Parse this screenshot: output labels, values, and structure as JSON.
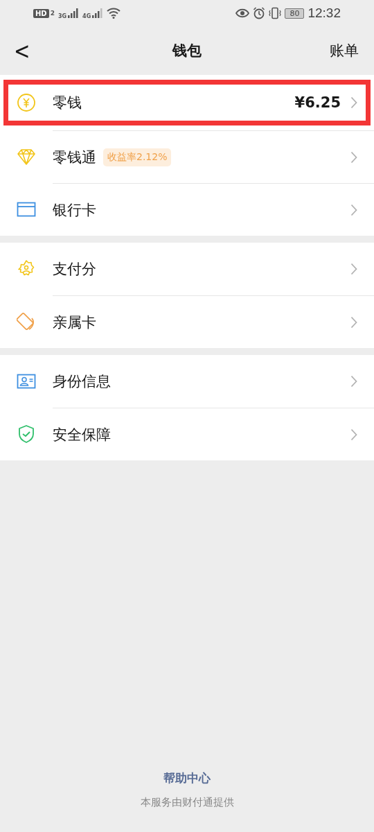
{
  "status_bar": {
    "hd": "HD",
    "sim": "2",
    "network_1": "3G",
    "network_2": "4G",
    "battery": "80",
    "time": "12:32"
  },
  "nav": {
    "back": "<",
    "title": "钱包",
    "action": "账单"
  },
  "groups": [
    {
      "items": [
        {
          "kind": "coin",
          "label": "零钱",
          "value": "¥6.25",
          "highlighted": true
        },
        {
          "kind": "diamond",
          "label": "零钱通",
          "tag": "收益率2.12%",
          "highlighted": false
        },
        {
          "kind": "card",
          "label": "银行卡",
          "highlighted": false
        }
      ]
    },
    {
      "items": [
        {
          "kind": "badge",
          "label": "支付分",
          "highlighted": false
        },
        {
          "kind": "family",
          "label": "亲属卡",
          "highlighted": false
        }
      ]
    },
    {
      "items": [
        {
          "kind": "id",
          "label": "身份信息",
          "highlighted": false
        },
        {
          "kind": "shield",
          "label": "安全保障",
          "highlighted": false
        }
      ]
    }
  ],
  "footer": {
    "help": "帮助中心",
    "provider": "本服务由财付通提供"
  }
}
